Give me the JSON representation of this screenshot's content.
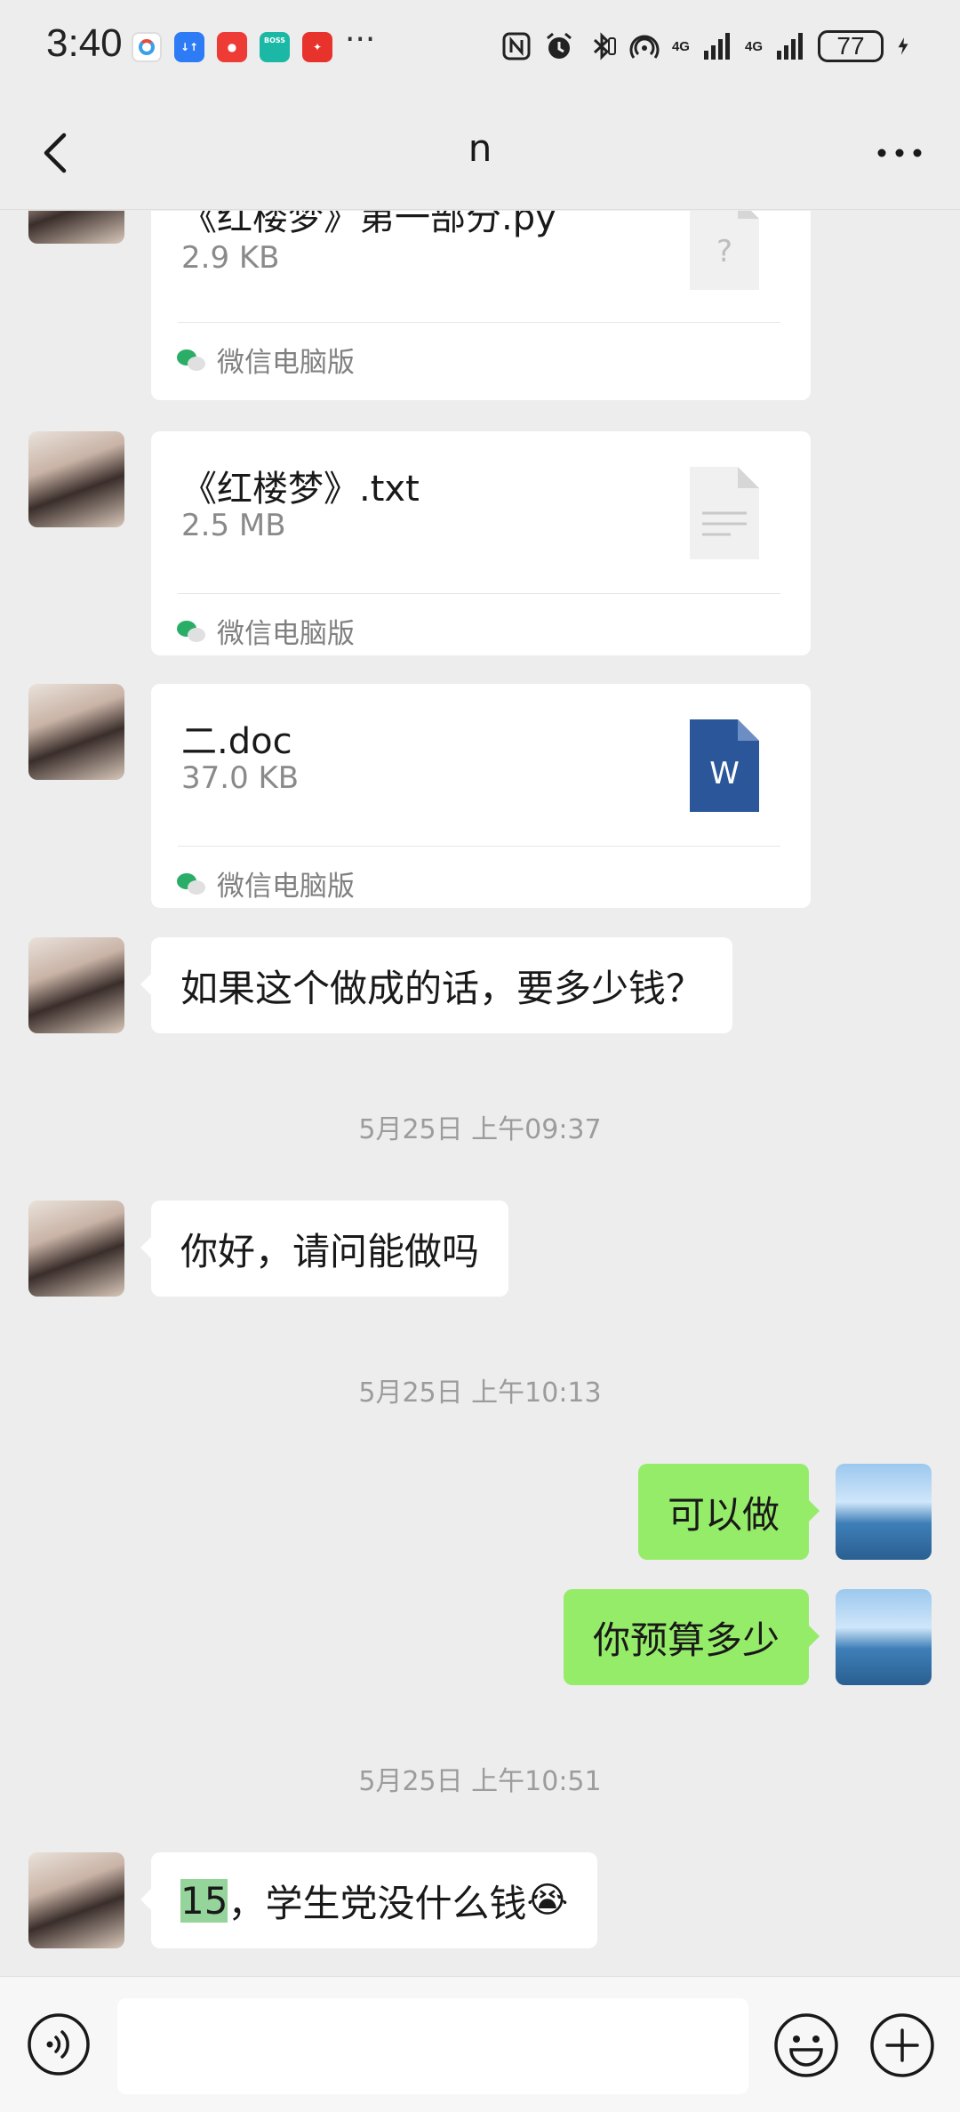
{
  "status_bar": {
    "time": "3:40",
    "more": "···",
    "sig1": "4G",
    "sig2": "4G",
    "battery": "77"
  },
  "nav": {
    "title": "n"
  },
  "files": [
    {
      "name": "《红楼梦》第一部分.py",
      "size": "2.9 KB",
      "source": "微信电脑版",
      "icon": "unknown-file-icon",
      "icon_glyph": "?"
    },
    {
      "name": "《红楼梦》.txt",
      "size": "2.5 MB",
      "source": "微信电脑版",
      "icon": "text-file-icon"
    },
    {
      "name": "二.doc",
      "size": "37.0 KB",
      "source": "微信电脑版",
      "icon": "word-file-icon",
      "icon_glyph": "W"
    }
  ],
  "messages": {
    "m1": "如果这个做成的话，要多少钱？",
    "ts1": "5月25日 上午09:37",
    "m2": "你好，请问能做吗",
    "ts2": "5月25日 上午10:13",
    "m3": "可以做",
    "m4": "你预算多少",
    "ts3": "5月25日 上午10:51",
    "m5_highlight": "15",
    "m5_rest": "，学生党没什么钱",
    "m5_emoji": "😭"
  },
  "colors": {
    "background": "#ededed",
    "outgoing_bubble": "#95ec69",
    "incoming_bubble": "#ffffff",
    "word_icon": "#2b579a"
  }
}
